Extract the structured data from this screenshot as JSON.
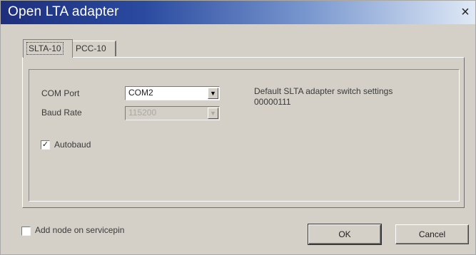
{
  "window": {
    "title": "Open LTA adapter",
    "close_symbol": "×"
  },
  "tabs": [
    {
      "label": "SLTA-10",
      "selected": true
    },
    {
      "label": "PCC-10",
      "selected": false
    }
  ],
  "com_port": {
    "label": "COM Port",
    "value": "COM2"
  },
  "baud_rate": {
    "label": "Baud Rate",
    "value": "115200",
    "enabled": false
  },
  "autobaud": {
    "label": "Autobaud",
    "checked": true,
    "check_glyph": "✓"
  },
  "info": {
    "line1": "Default SLTA adapter switch settings",
    "line2": "00000111"
  },
  "add_node": {
    "label": "Add node on servicepin",
    "checked": false
  },
  "buttons": {
    "ok": "OK",
    "cancel": "Cancel"
  },
  "icons": {
    "dropdown": "chevron-down-icon",
    "close": "close-icon"
  }
}
